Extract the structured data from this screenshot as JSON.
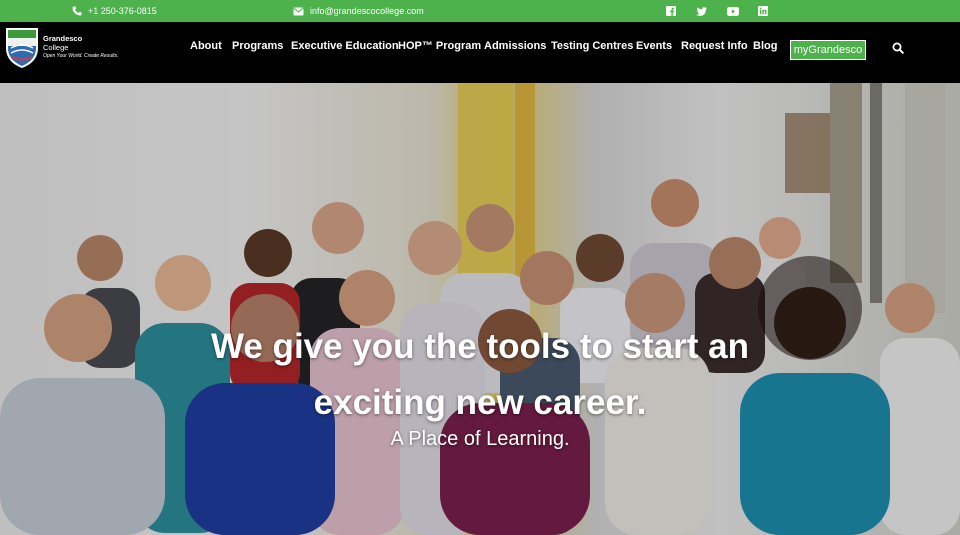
{
  "topbar": {
    "phone": "+1 250-376-0815",
    "email": "info@grandescocollege.com",
    "social": [
      "facebook-icon",
      "twitter-icon",
      "youtube-icon",
      "linkedin-icon"
    ]
  },
  "logo": {
    "name": "Grandesco",
    "sub": "College",
    "tagline": "Open Your World. Create Results."
  },
  "nav": {
    "items": [
      "About",
      "Programs",
      "Executive Education",
      "HOP™ Program",
      "Admissions",
      "Testing Centres",
      "Events",
      "Request Info",
      "Blog"
    ],
    "cta": "myGrandesco"
  },
  "hero": {
    "headline_line1": "We give you the tools to start an",
    "headline_line2": "exciting new career.",
    "subtitle": "A Place of Learning."
  },
  "colors": {
    "accent_green": "#4db24b",
    "nav_bg": "#000000"
  }
}
